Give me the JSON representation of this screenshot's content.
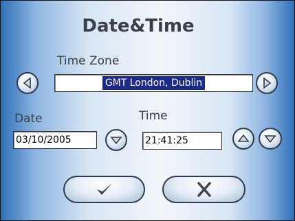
{
  "dialog": {
    "title": "Date&Time",
    "time_zone_label": "Time Zone",
    "time_zone_value": "GMT London, Dublin",
    "date_label": "Date",
    "date_value": "03/10/2005",
    "time_label": "Time",
    "time_value": "21:41:25"
  },
  "icons": {
    "prev": "triangle-left-icon",
    "next": "triangle-right-icon",
    "down": "triangle-down-icon",
    "up": "triangle-up-icon",
    "ok": "checkmark-icon",
    "cancel": "x-icon"
  }
}
